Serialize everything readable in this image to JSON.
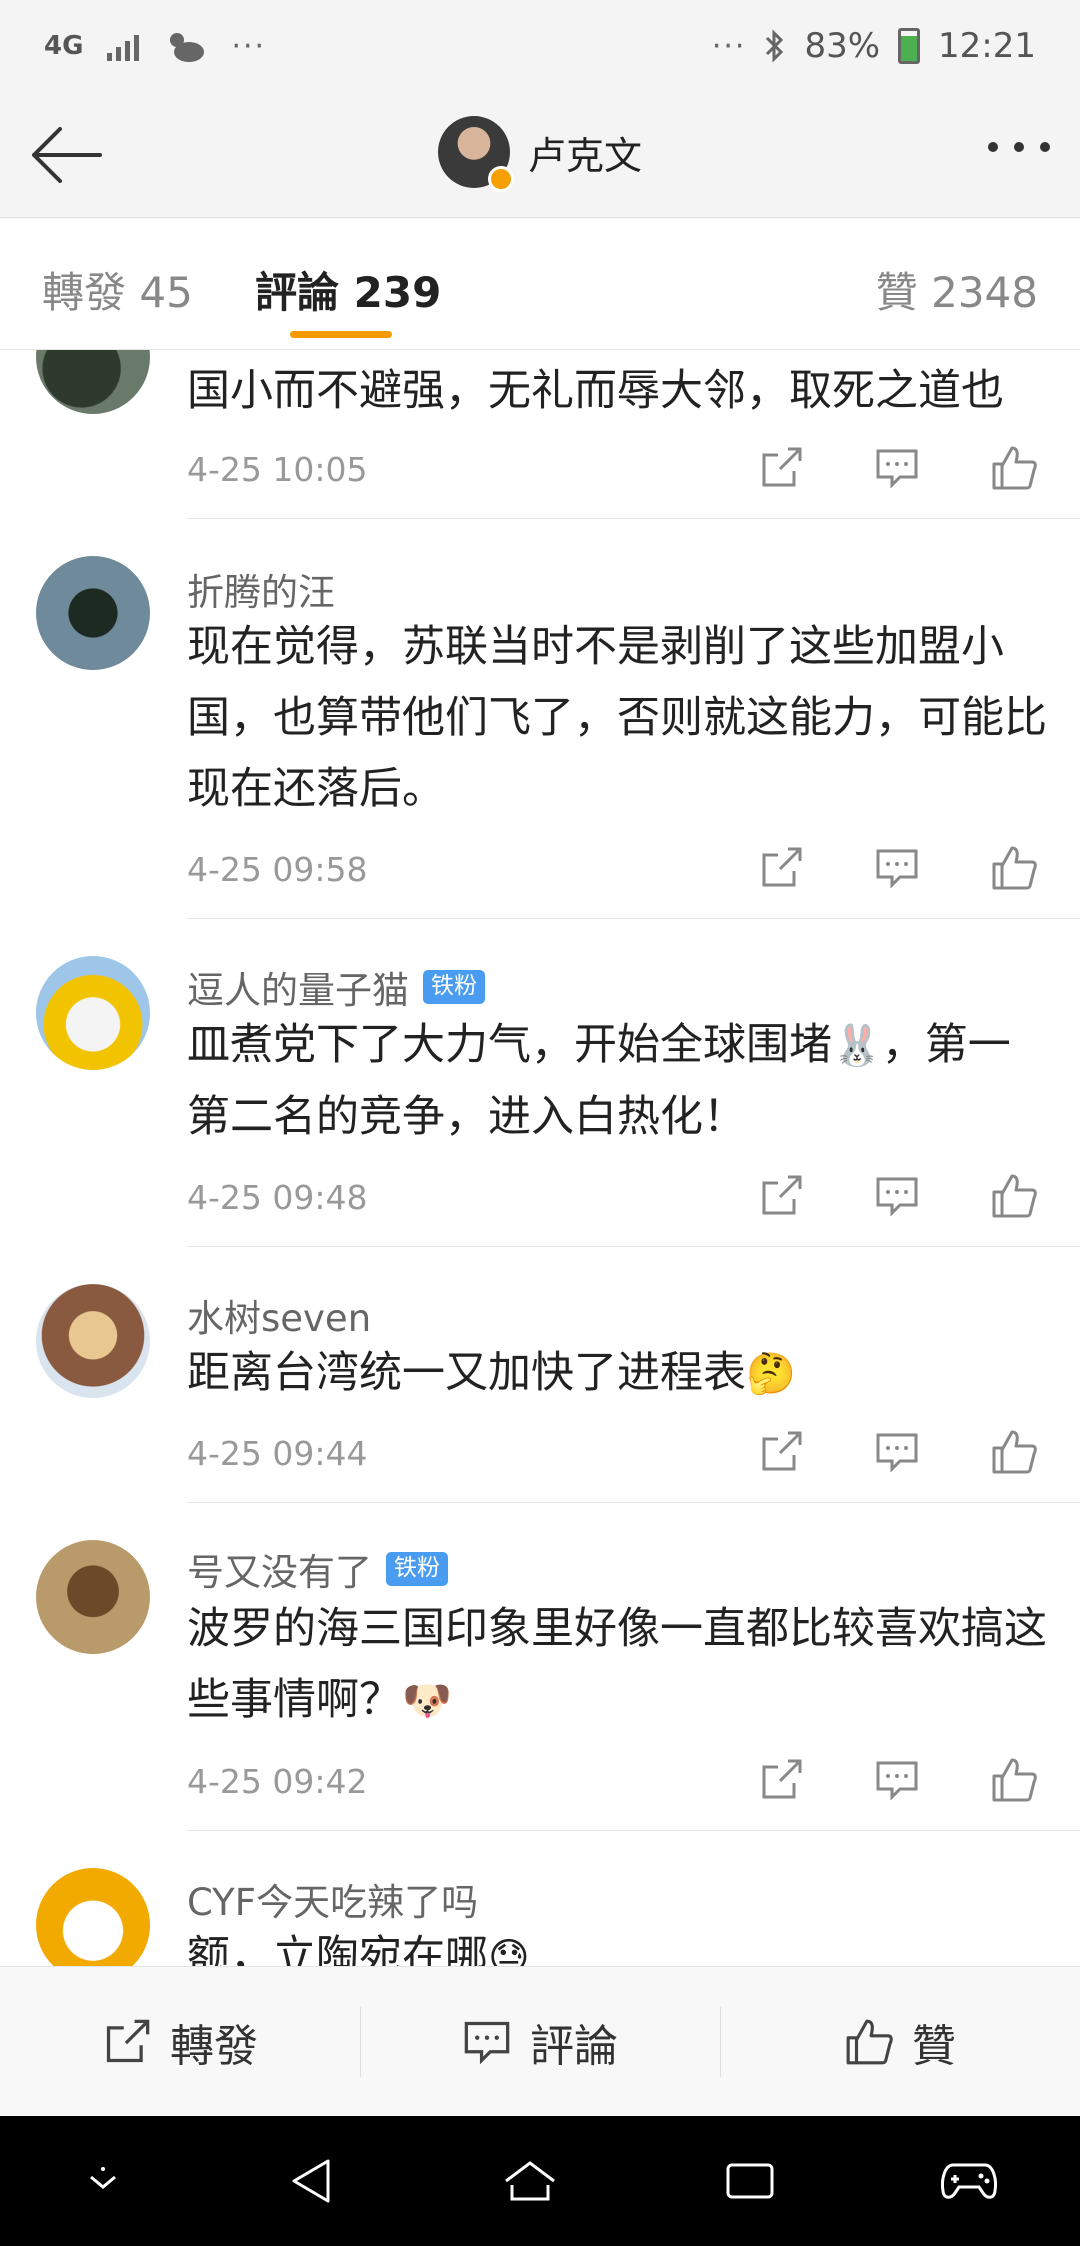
{
  "status_bar": {
    "network": "4G",
    "more_dots": "···",
    "right_dots": "···",
    "battery": "83%",
    "time": "12:21"
  },
  "nav": {
    "title": "卢克文"
  },
  "tabs": {
    "repost": "轉發 45",
    "comments": "評論 239",
    "likes": "贊 2348"
  },
  "comments": [
    {
      "name": "",
      "text": "国小而不避强，无礼而辱大邻，取死之道也",
      "time": "4-25 10:05"
    },
    {
      "name": "折腾的汪",
      "text": "现在觉得，苏联当时不是剥削了这些加盟小国，也算带他们飞了，否则就这能力，可能比现在还落后。",
      "time": "4-25 09:58"
    },
    {
      "name": "逗人的量子猫",
      "badge": "铁粉",
      "text": "皿煮党下了大力气，开始全球围堵",
      "emoji": "🐰",
      "text2": "，第一第二名的竞争，进入白热化！",
      "time": "4-25 09:48"
    },
    {
      "name": "水树seven",
      "text": "距离台湾统一又加快了进程表",
      "emoji": "🤔",
      "time": "4-25 09:44"
    },
    {
      "name": "号又没有了",
      "badge": "铁粉",
      "text": "波罗的海三国印象里好像一直都比较喜欢搞这些事情啊？",
      "emoji": "🐶",
      "time": "4-25 09:42"
    },
    {
      "name": "CYF今天吃辣了吗",
      "text": "额，立陶宛在哪",
      "emoji": "😓"
    }
  ],
  "bottom_bar": {
    "repost": "轉發",
    "comment": "評論",
    "like": "贊"
  },
  "colors": {
    "accent": "#f59a00",
    "fan_badge": "#4a9cf0"
  }
}
